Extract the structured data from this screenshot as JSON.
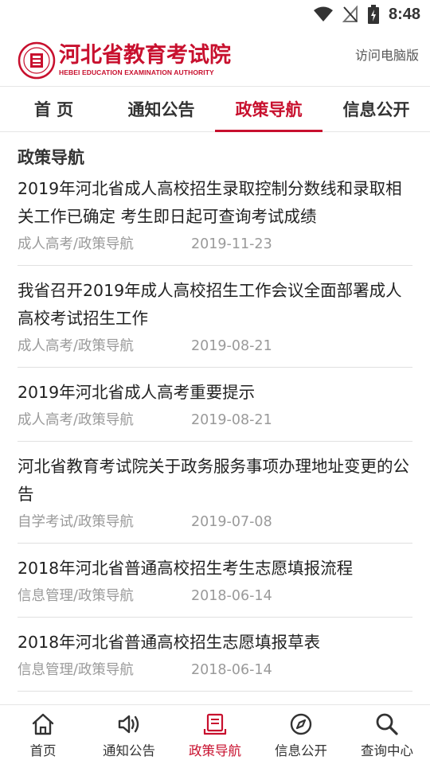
{
  "status_bar": {
    "time": "8:48",
    "icons": [
      "wifi-icon",
      "no-signal-icon",
      "battery-charging-icon"
    ]
  },
  "header": {
    "logo_cn": "河北省教育考试院",
    "logo_en": "HEBEI EDUCATION EXAMINATION AUTHORITY",
    "desktop_link": "访问电脑版"
  },
  "top_nav": {
    "tabs": [
      {
        "label": "首 页"
      },
      {
        "label": "通知公告"
      },
      {
        "label": "政策导航"
      },
      {
        "label": "信息公开"
      }
    ],
    "active_index": 2
  },
  "section_title": "政策导航",
  "articles": [
    {
      "title": "2019年河北省成人高校招生录取控制分数线和录取相关工作已确定 考生即日起可查询考试成绩",
      "category": "成人高考/政策导航",
      "date": "2019-11-23"
    },
    {
      "title": "我省召开2019年成人高校招生工作会议全面部署成人高校考试招生工作",
      "category": "成人高考/政策导航",
      "date": "2019-08-21"
    },
    {
      "title": "2019年河北省成人高考重要提示",
      "category": "成人高考/政策导航",
      "date": "2019-08-21"
    },
    {
      "title": "河北省教育考试院关于政务服务事项办理地址变更的公告",
      "category": "自学考试/政策导航",
      "date": "2019-07-08"
    },
    {
      "title": "2018年河北省普通高校招生考生志愿填报流程",
      "category": "信息管理/政策导航",
      "date": "2018-06-14"
    },
    {
      "title": "2018年河北省普通高校招生志愿填报草表",
      "category": "信息管理/政策导航",
      "date": "2018-06-14"
    }
  ],
  "bottom_nav": {
    "items": [
      {
        "label": "首页",
        "icon": "home-icon"
      },
      {
        "label": "通知公告",
        "icon": "speaker-icon"
      },
      {
        "label": "政策导航",
        "icon": "policy-doc-icon"
      },
      {
        "label": "信息公开",
        "icon": "compass-icon"
      },
      {
        "label": "查询中心",
        "icon": "search-icon"
      }
    ],
    "active_index": 2
  },
  "colors": {
    "brand": "#c8102e",
    "text": "#222222",
    "meta": "#9a9a9a"
  }
}
